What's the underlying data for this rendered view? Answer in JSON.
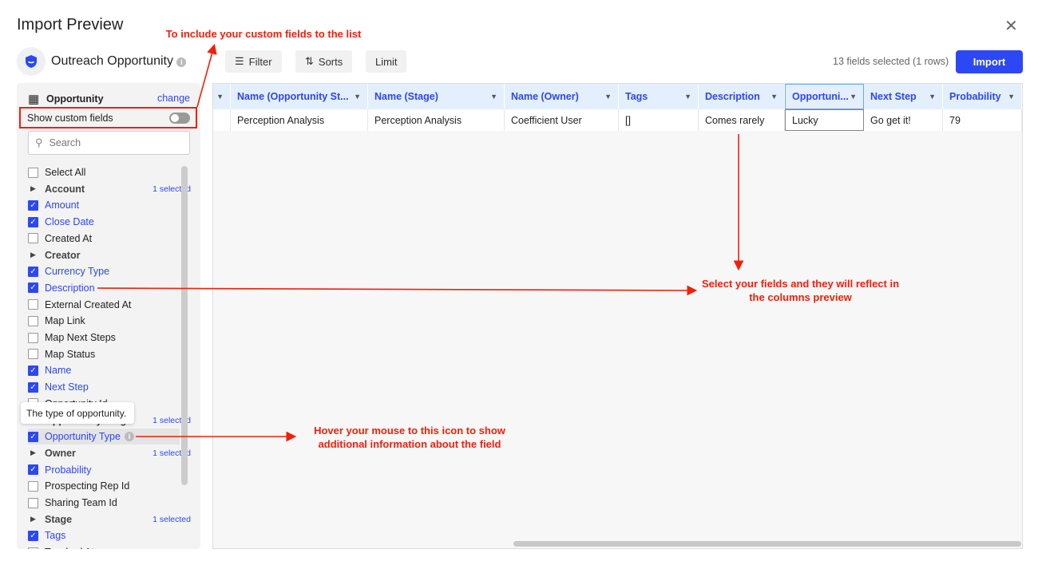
{
  "dialog": {
    "title": "Import Preview",
    "close_icon": "close-icon"
  },
  "source": {
    "name": "Outreach Opportunity",
    "icon": "shield-icon"
  },
  "toolbar": {
    "filter": "Filter",
    "sorts": "Sorts",
    "limit": "Limit",
    "count": "13 fields selected (1 rows)",
    "import": "Import"
  },
  "sidebar": {
    "object": "Opportunity",
    "change": "change",
    "custom_fields_label": "Show custom fields",
    "custom_fields_on": false,
    "search_placeholder": "Search",
    "items": [
      {
        "label": "Select All",
        "type": "field",
        "checked": false
      },
      {
        "label": "Account",
        "type": "group",
        "badge": "1 selected"
      },
      {
        "label": "Amount",
        "type": "field",
        "checked": true
      },
      {
        "label": "Close Date",
        "type": "field",
        "checked": true
      },
      {
        "label": "Created At",
        "type": "field",
        "checked": false
      },
      {
        "label": "Creator",
        "type": "group",
        "badge": ""
      },
      {
        "label": "Currency Type",
        "type": "field",
        "checked": true
      },
      {
        "label": "Description",
        "type": "field",
        "checked": true
      },
      {
        "label": "External Created At",
        "type": "field",
        "checked": false
      },
      {
        "label": "Map Link",
        "type": "field",
        "checked": false
      },
      {
        "label": "Map Next Steps",
        "type": "field",
        "checked": false
      },
      {
        "label": "Map Status",
        "type": "field",
        "checked": false
      },
      {
        "label": "Name",
        "type": "field",
        "checked": true
      },
      {
        "label": "Next Step",
        "type": "field",
        "checked": true
      },
      {
        "label": "Opportunity Id",
        "type": "field",
        "checked": false
      },
      {
        "label": "Opportunity Stage",
        "type": "group",
        "badge": "1 selected"
      },
      {
        "label": "Opportunity Type",
        "type": "field",
        "checked": true,
        "info": true
      },
      {
        "label": "Owner",
        "type": "group",
        "badge": "1 selected"
      },
      {
        "label": "Probability",
        "type": "field",
        "checked": true
      },
      {
        "label": "Prospecting Rep Id",
        "type": "field",
        "checked": false
      },
      {
        "label": "Sharing Team Id",
        "type": "field",
        "checked": false
      },
      {
        "label": "Stage",
        "type": "group",
        "badge": "1 selected"
      },
      {
        "label": "Tags",
        "type": "field",
        "checked": true
      },
      {
        "label": "Touched At",
        "type": "field",
        "checked": false
      }
    ],
    "tooltip": "The type of opportunity."
  },
  "table": {
    "columns": [
      "",
      "Name (Opportunity St...",
      "Name (Stage)",
      "Name (Owner)",
      "Tags",
      "Description",
      "Opportuni...",
      "Next Step",
      "Probability"
    ],
    "rows": [
      [
        "",
        "Perception Analysis",
        "Perception Analysis",
        "Coefficient User",
        "[]",
        "Comes rarely",
        "Lucky",
        "Go get it!",
        "79"
      ]
    ]
  },
  "annotations": {
    "custom": "To include your custom fields to the list",
    "select": "Select your fields and they will reflect in the columns preview",
    "hover": "Hover your mouse to this icon to show additional information about the field",
    "color": "#f0200a"
  },
  "colors": {
    "accent": "#2c47f5",
    "header_bg": "#e3effc"
  }
}
